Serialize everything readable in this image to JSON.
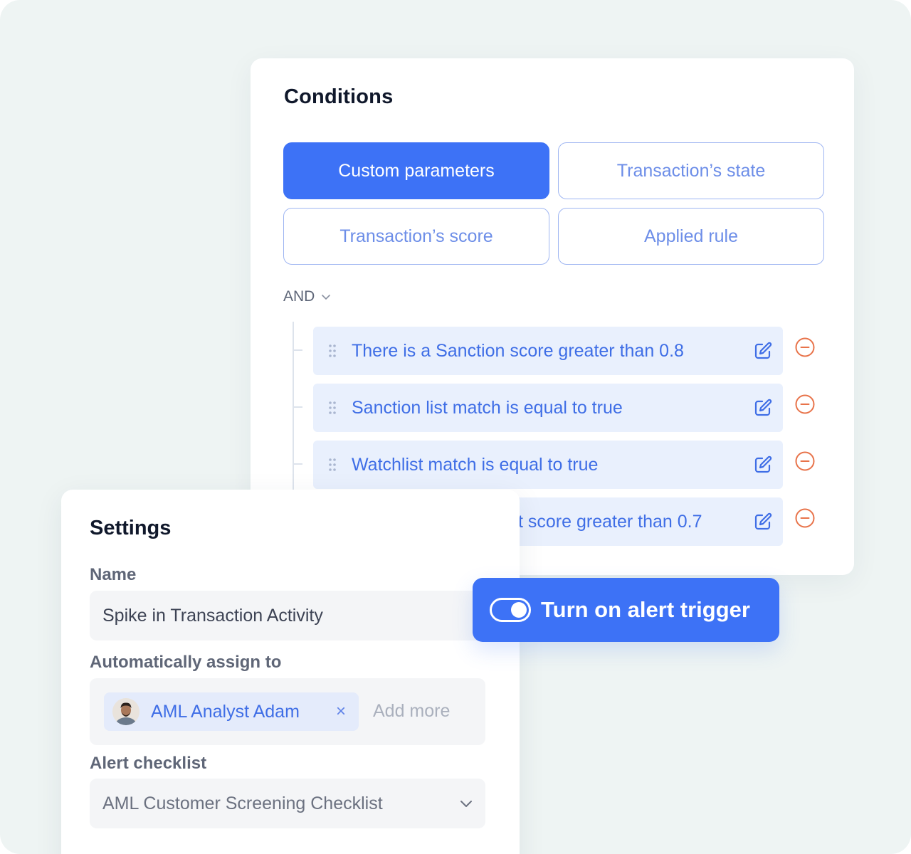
{
  "colors": {
    "background": "#eef4f3",
    "accent": "#3d72f6",
    "condition_row": "#e9f0fd",
    "remove": "#e8734a"
  },
  "conditions": {
    "title": "Conditions",
    "chips": [
      {
        "label": "Custom parameters",
        "active": true
      },
      {
        "label": "Transaction’s state",
        "active": false
      },
      {
        "label": "Transaction’s score",
        "active": false
      },
      {
        "label": "Applied rule",
        "active": false
      }
    ],
    "operator": "AND",
    "rows": [
      {
        "text": "There is a Sanction score greater than 0.8",
        "drag_icon": "drag-handle-icon",
        "edit_icon": "edit-icon",
        "remove_icon": "minus-circle-icon"
      },
      {
        "text": "Sanction list match is equal to true",
        "drag_icon": "drag-handle-icon",
        "edit_icon": "edit-icon",
        "remove_icon": "minus-circle-icon"
      },
      {
        "text": "Watchlist match is equal to true",
        "drag_icon": "drag-handle-icon",
        "edit_icon": "edit-icon",
        "remove_icon": "minus-circle-icon"
      },
      {
        "text": "t score greater than 0.7",
        "drag_icon": "drag-handle-icon",
        "edit_icon": "edit-icon",
        "remove_icon": "minus-circle-icon"
      }
    ]
  },
  "settings": {
    "title": "Settings",
    "name_label": "Name",
    "name_value": "Spike in Transaction Activity",
    "assign_label": "Automatically assign to",
    "assignee": "AML Analyst Adam",
    "assignee_remove": "×",
    "add_more_placeholder": "Add more",
    "checklist_label": "Alert checklist",
    "checklist_value": "AML Customer Screening Checklist"
  },
  "alert_toggle": {
    "label": "Turn on alert trigger",
    "on": true
  }
}
